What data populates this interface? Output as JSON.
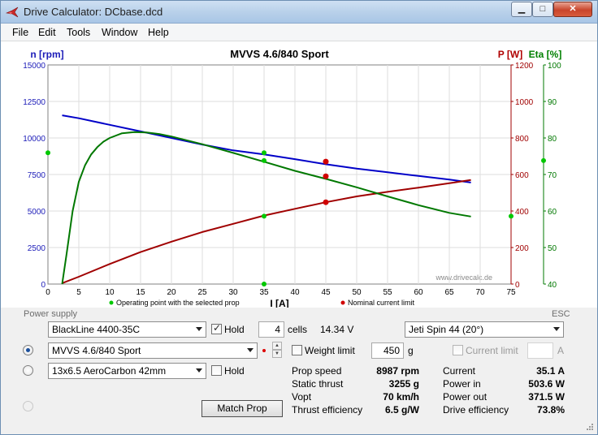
{
  "window": {
    "title": "Drive Calculator: DCbase.dcd",
    "minimize_glyph": "▁",
    "maximize_glyph": "□",
    "close_glyph": "✕"
  },
  "menu": [
    "File",
    "Edit",
    "Tools",
    "Window",
    "Help"
  ],
  "chart_data": {
    "type": "line",
    "title": "MVVS 4.6/840 Sport",
    "xlabel": "I [A]",
    "ylabel_left": "n [rpm]",
    "ylabel_p": "P [W]",
    "ylabel_eta": "Eta [%]",
    "xlim": [
      0,
      75
    ],
    "ylim_left": [
      0,
      15000
    ],
    "ylim_p": [
      0,
      1200
    ],
    "ylim_eta": [
      40,
      100
    ],
    "x_ticks": [
      0,
      5,
      10,
      15,
      20,
      25,
      30,
      35,
      40,
      45,
      50,
      55,
      60,
      65,
      70,
      75
    ],
    "left_ticks": [
      0,
      2500,
      5000,
      7500,
      10000,
      12500,
      15000
    ],
    "p_ticks": [
      0,
      200,
      400,
      600,
      800,
      1000,
      1200
    ],
    "eta_ticks": [
      40,
      50,
      60,
      70,
      80,
      90,
      100
    ],
    "grid": true,
    "watermark": "www.drivecalc.de",
    "colors": {
      "rpm": "#0000c8",
      "power": "#a00000",
      "eta": "#007800",
      "op_point": "#00c800",
      "nominal": "#d00000"
    },
    "series": [
      {
        "name": "n [rpm]",
        "axis": "left",
        "color": "#0000c8",
        "x": [
          2.3,
          5,
          10,
          15,
          20,
          25,
          30,
          35,
          40,
          45,
          50,
          55,
          60,
          65,
          68.5
        ],
        "y": [
          11550,
          11350,
          10900,
          10450,
          10000,
          9550,
          9150,
          8880,
          8550,
          8200,
          7900,
          7650,
          7400,
          7150,
          6950
        ]
      },
      {
        "name": "P [W]",
        "axis": "p",
        "color": "#a00000",
        "x": [
          2.3,
          5,
          10,
          15,
          20,
          25,
          30,
          35,
          40,
          45,
          50,
          55,
          60,
          65,
          68.5
        ],
        "y": [
          5,
          40,
          110,
          175,
          232,
          285,
          330,
          375,
          412,
          448,
          480,
          505,
          528,
          552,
          570
        ]
      },
      {
        "name": "Eta [%]",
        "axis": "eta",
        "color": "#007800",
        "x": [
          2.3,
          3,
          4,
          5,
          6,
          7,
          8,
          9,
          10,
          12,
          14,
          16,
          18,
          20,
          25,
          30,
          35,
          40,
          45,
          50,
          55,
          60,
          65,
          68.5
        ],
        "y": [
          40,
          48,
          60,
          68,
          72.5,
          75.5,
          77.5,
          79,
          80,
          81.3,
          81.6,
          81.5,
          81.1,
          80.4,
          78.3,
          75.9,
          73.5,
          71,
          68.8,
          66.5,
          64,
          61.6,
          59.5,
          58.5
        ]
      }
    ],
    "operating_points": [
      {
        "axis": "left",
        "x": 35,
        "y": 8987
      },
      {
        "axis": "p",
        "x": 35,
        "y": 371.5
      },
      {
        "axis": "eta",
        "x": 35,
        "y": 73.8
      },
      {
        "axis": "left",
        "x": 35,
        "y": 0
      },
      {
        "axis": "left",
        "x": 0,
        "y": 8987
      },
      {
        "axis": "p",
        "x": 75,
        "y": 371.5
      },
      {
        "axis": "eta",
        "x": 75,
        "y": 73.8
      }
    ],
    "nominal_points": [
      {
        "axis": "left",
        "x": 45,
        "y": 8380
      },
      {
        "axis": "p",
        "x": 45,
        "y": 448
      },
      {
        "axis": "eta",
        "x": 45,
        "y": 69.5
      }
    ],
    "legend_op_label": "Operating point with the selected prop",
    "legend_nominal_label": "Nominal current limit"
  },
  "power_supply": {
    "section_label": "Power supply",
    "battery": "BlackLine 4400-35C",
    "hold_label": "Hold",
    "hold_checked": true,
    "cells": "4",
    "cells_label": "cells",
    "voltage": "14.34 V"
  },
  "esc": {
    "section_label": "ESC",
    "value": "Jeti Spin 44 (20°)"
  },
  "motor": {
    "value": "MVVS 4.6/840 Sport",
    "weight_limit_label": "Weight limit",
    "weight_limit_value": "450",
    "weight_unit": "g",
    "current_limit_label": "Current limit",
    "current_unit": "A"
  },
  "prop": {
    "value": "13x6.5 AeroCarbon 42mm",
    "hold_label": "Hold"
  },
  "match_prop_label": "Match Prop",
  "results_left": [
    {
      "label": "Prop speed",
      "value": "8987 rpm"
    },
    {
      "label": "Static thrust",
      "value": "3255 g"
    },
    {
      "label": "Vopt",
      "value": "70 km/h"
    },
    {
      "label": "Thrust efficiency",
      "value": "6.5 g/W"
    }
  ],
  "results_right": [
    {
      "label": "Current",
      "value": "35.1 A"
    },
    {
      "label": "Power in",
      "value": "503.6 W"
    },
    {
      "label": "Power out",
      "value": "371.5 W"
    },
    {
      "label": "Drive efficiency",
      "value": "73.8%"
    }
  ]
}
